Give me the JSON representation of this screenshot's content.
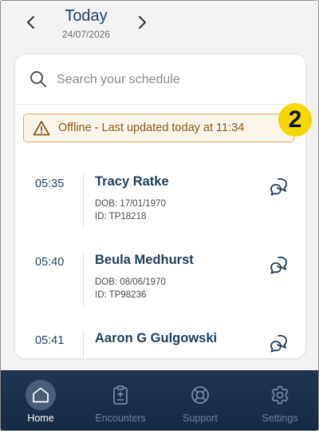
{
  "header": {
    "title": "Today",
    "date": "24/07/2026"
  },
  "search": {
    "placeholder": "Search your schedule"
  },
  "offline_banner": {
    "text": "Offline - Last updated today at 11:34"
  },
  "badge": {
    "value": "2"
  },
  "appointments": [
    {
      "time": "05:35",
      "name": "Tracy Ratke",
      "dob": "DOB: 17/01/1970",
      "id": "ID: TP18218"
    },
    {
      "time": "05:40",
      "name": "Beula Medhurst",
      "dob": "DOB: 08/06/1970",
      "id": "ID: TP98236"
    },
    {
      "time": "05:41",
      "name": "Aaron G Gulgowski",
      "dob": "",
      "id": ""
    }
  ],
  "tabs": [
    {
      "label": "Home",
      "icon": "home-icon",
      "active": true
    },
    {
      "label": "Encounters",
      "icon": "clipboard-icon",
      "active": false
    },
    {
      "label": "Support",
      "icon": "lifebuoy-icon",
      "active": false
    },
    {
      "label": "Settings",
      "icon": "gear-icon",
      "active": false
    }
  ],
  "colors": {
    "primary": "#1f3e5c",
    "banner_bg": "#fdf5ea",
    "banner_border": "#e5a55a",
    "banner_text": "#8a5a1c",
    "badge": "#f5d800",
    "tab_bar": "#1f3650"
  }
}
